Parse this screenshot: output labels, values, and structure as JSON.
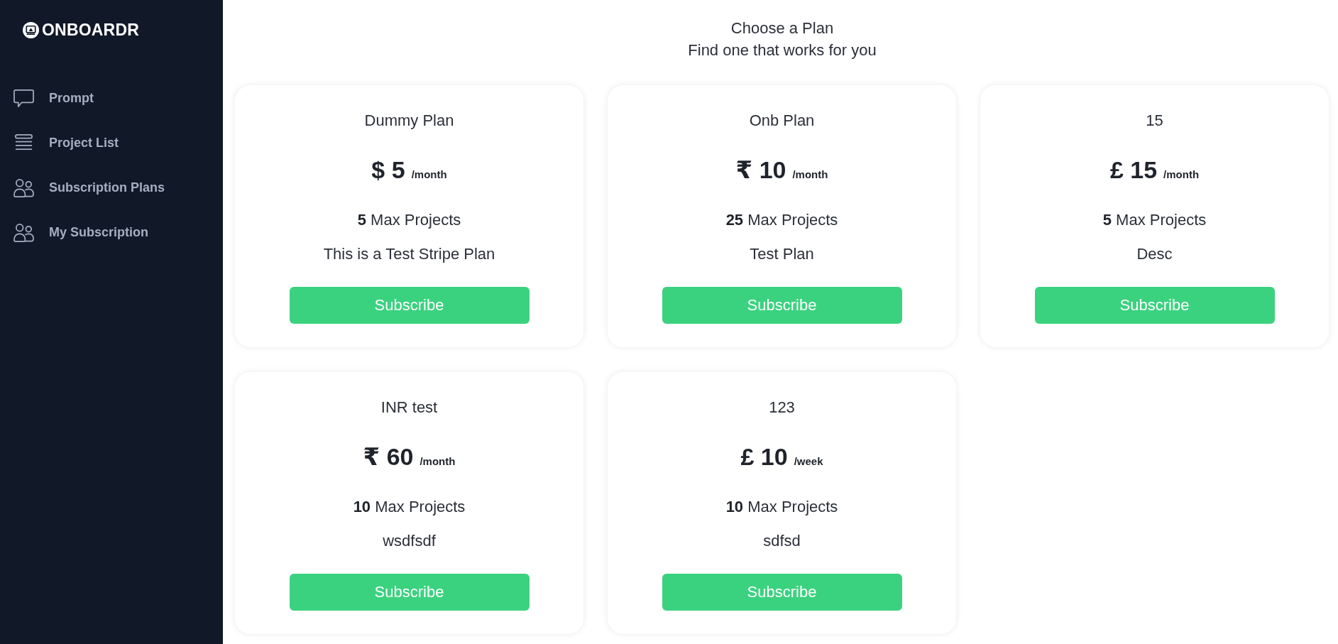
{
  "brand": {
    "name": "ONBOARDR"
  },
  "sidebar": {
    "items": [
      {
        "label": "Prompt",
        "selected": false
      },
      {
        "label": "Project List",
        "selected": false
      },
      {
        "label": "Subscription Plans",
        "selected": false
      },
      {
        "label": "My Subscription",
        "selected": false
      }
    ]
  },
  "header": {
    "title": "Choose a Plan",
    "subtitle": "Find one that works for you"
  },
  "plans": [
    {
      "name": "Dummy Plan",
      "price": "$ 5",
      "period": "/month",
      "max_projects": "**5** Max Projects",
      "description": "This is a Test Stripe Plan",
      "button": "Subscribe"
    },
    {
      "name": "Onb Plan",
      "price": "₹ 10",
      "period": "/month",
      "max_projects": "**25** Max Projects",
      "description": "Test Plan",
      "button": "Subscribe"
    },
    {
      "name": "15",
      "price": "£ 15",
      "period": "/month",
      "max_projects": "**5** Max Projects",
      "description": "Desc",
      "button": "Subscribe"
    },
    {
      "name": "INR test",
      "price": "₹ 60",
      "period": "/month",
      "max_projects": "**10** Max Projects",
      "description": "wsdfsdf",
      "button": "Subscribe"
    },
    {
      "name": "123",
      "price": "£ 10",
      "period": "/week",
      "max_projects": "**10** Max Projects",
      "description": "sdfsd",
      "button": "Subscribe"
    }
  ]
}
